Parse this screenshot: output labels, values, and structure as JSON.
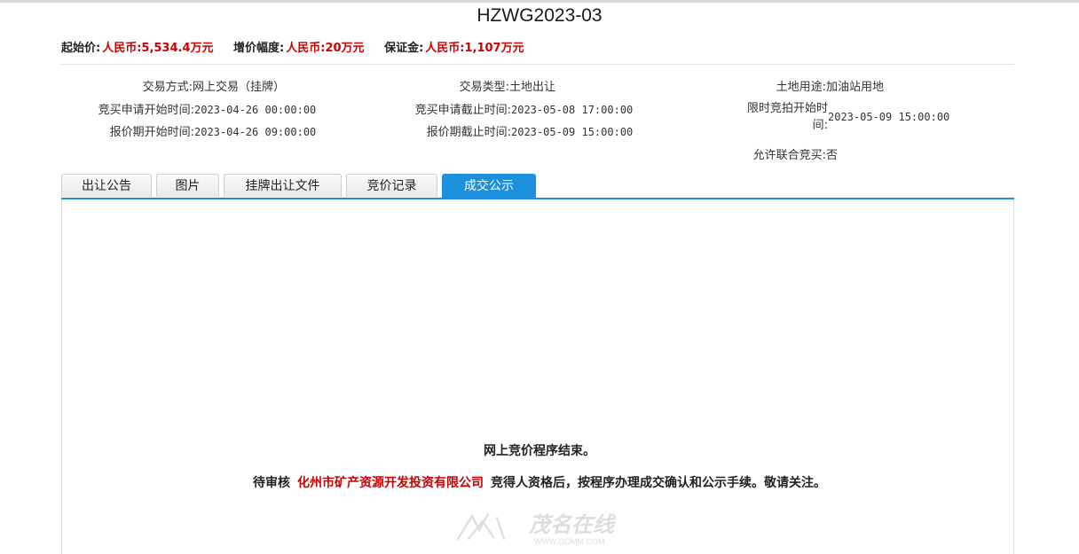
{
  "title": "HZWG2023-03",
  "price_bar": {
    "start_price_label": "起始价:",
    "start_price_value": "人民币:5,534.4万元",
    "increment_label": "增价幅度:",
    "increment_value": "人民币:20万元",
    "deposit_label": "保证金:",
    "deposit_value": "人民币:1,107万元"
  },
  "info": {
    "trade_method_label": "交易方式:",
    "trade_method_value": "网上交易（挂牌）",
    "trade_type_label": "交易类型:",
    "trade_type_value": "土地出让",
    "land_use_label": "土地用途:",
    "land_use_value": "加油站用地",
    "apply_start_label": "竞买申请开始时间:",
    "apply_start_value": "2023-04-26 00:00:00",
    "apply_end_label": "竞买申请截止时间:",
    "apply_end_value": "2023-05-08 17:00:00",
    "bid_start_label_line1": "限时竞拍开始时",
    "bid_start_label_line2": "间:",
    "bid_start_value": "2023-05-09 15:00:00",
    "quote_start_label": "报价期开始时间:",
    "quote_start_value": "2023-04-26 09:00:00",
    "quote_end_label": "报价期截止时间:",
    "quote_end_value": "2023-05-09 15:00:00",
    "joint_label": "允许联合竞买:",
    "joint_value": "否"
  },
  "tabs": [
    "出让公告",
    "图片",
    "挂牌出让文件",
    "竞价记录",
    "成交公示"
  ],
  "active_tab_index": 4,
  "colors": {
    "accent": "#1c8fdd",
    "price_red": "#cc0000"
  },
  "result": {
    "line1": "网上竞价程序结束。",
    "line2_prefix": "待审核",
    "company": "化州市矿产资源开发投资有限公司",
    "line2_suffix": "竞得人资格后，按程序办理成交确认和公示手续。敬请关注。"
  },
  "watermark": {
    "text": "茂名在线",
    "url_text": "WWW.GDMM.COM"
  }
}
